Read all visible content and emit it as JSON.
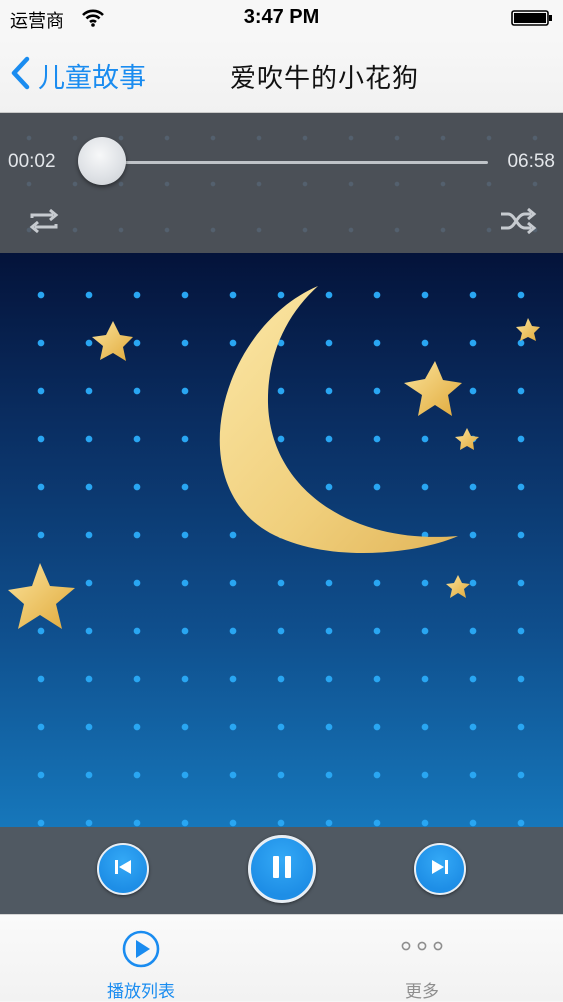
{
  "status_bar": {
    "carrier": "运营商",
    "time": "3:47 PM"
  },
  "nav": {
    "back_label": "儿童故事",
    "title": "爱吹牛的小花狗"
  },
  "player": {
    "elapsed": "00:02",
    "total": "06:58",
    "progress": 0.005
  },
  "tabs": [
    {
      "label": "播放列表",
      "icon": "play-circle-icon",
      "active": true
    },
    {
      "label": "更多",
      "icon": "more-dots-icon",
      "active": false
    }
  ],
  "colors": {
    "accent": "#1a8cf0",
    "panel": "#4b5057",
    "controls": "#505962",
    "sky_top": "#04133a",
    "sky_bottom": "#1677bb",
    "moon": "#f5d98a"
  }
}
